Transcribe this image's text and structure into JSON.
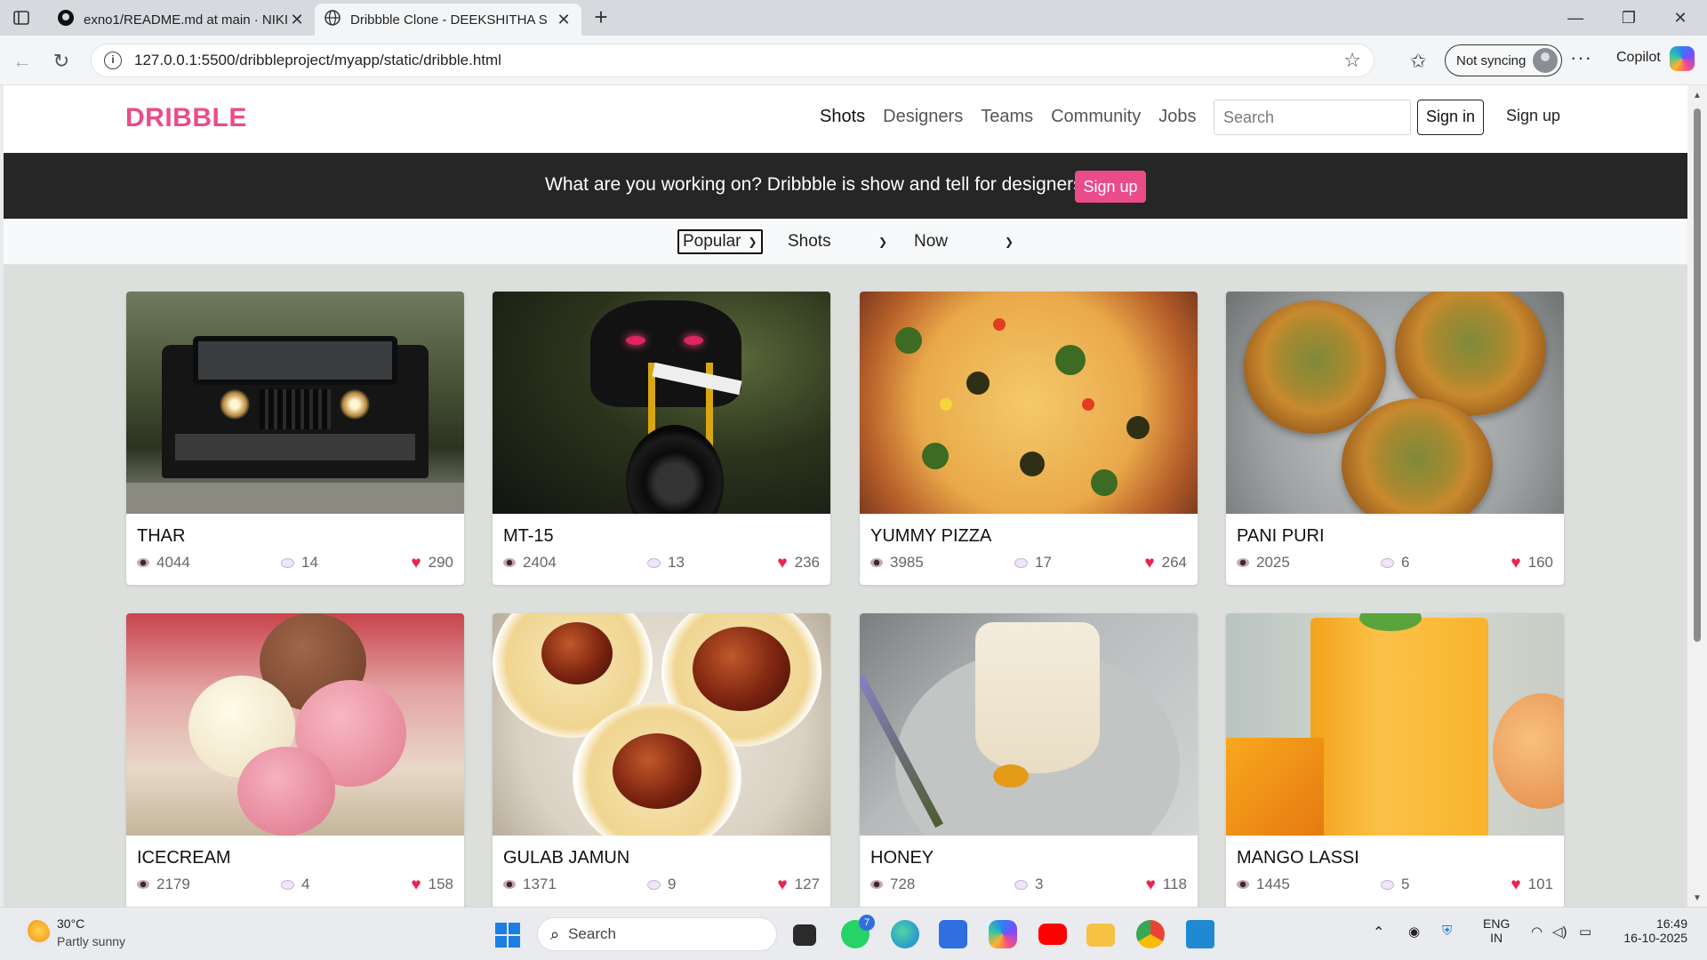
{
  "browser": {
    "tabs": [
      {
        "title": "exno1/README.md at main · NIKI"
      },
      {
        "title": "Dribbble Clone - DEEKSHITHA S"
      }
    ],
    "url": "127.0.0.1:5500/dribbleproject/myapp/static/dribble.html",
    "sync_label": "Not syncing",
    "copilot_label": "Copilot"
  },
  "site": {
    "logo": "DRIBBLE",
    "nav": [
      "Shots",
      "Designers",
      "Teams",
      "Community",
      "Jobs"
    ],
    "search_placeholder": "Search",
    "sign_in": "Sign in",
    "sign_up": "Sign up"
  },
  "banner": {
    "message": "What are you working on? Dribbble is show and tell for designers.",
    "button": "Sign up"
  },
  "filters": {
    "sort": "Popular",
    "type": "Shots",
    "time": "Now"
  },
  "shots": [
    {
      "title": "THAR",
      "views": "4044",
      "comments": "14",
      "likes": "290"
    },
    {
      "title": "MT-15",
      "views": "2404",
      "comments": "13",
      "likes": "236"
    },
    {
      "title": "YUMMY PIZZA",
      "views": "3985",
      "comments": "17",
      "likes": "264"
    },
    {
      "title": "PANI PURI",
      "views": "2025",
      "comments": "6",
      "likes": "160"
    },
    {
      "title": "ICECREAM",
      "views": "2179",
      "comments": "4",
      "likes": "158"
    },
    {
      "title": "GULAB JAMUN",
      "views": "1371",
      "comments": "9",
      "likes": "127"
    },
    {
      "title": "HONEY",
      "views": "728",
      "comments": "3",
      "likes": "118"
    },
    {
      "title": "MANGO LASSI",
      "views": "1445",
      "comments": "5",
      "likes": "101"
    }
  ],
  "taskbar": {
    "temperature": "30°C",
    "weather": "Partly sunny",
    "search": "Search",
    "whatsapp_badge": "7",
    "lang": "ENG",
    "region": "IN",
    "time": "16:49",
    "date": "16-10-2025"
  },
  "colors": {
    "brand": "#ea4c89",
    "banner_bg": "#262626",
    "heart": "#e8244f"
  }
}
